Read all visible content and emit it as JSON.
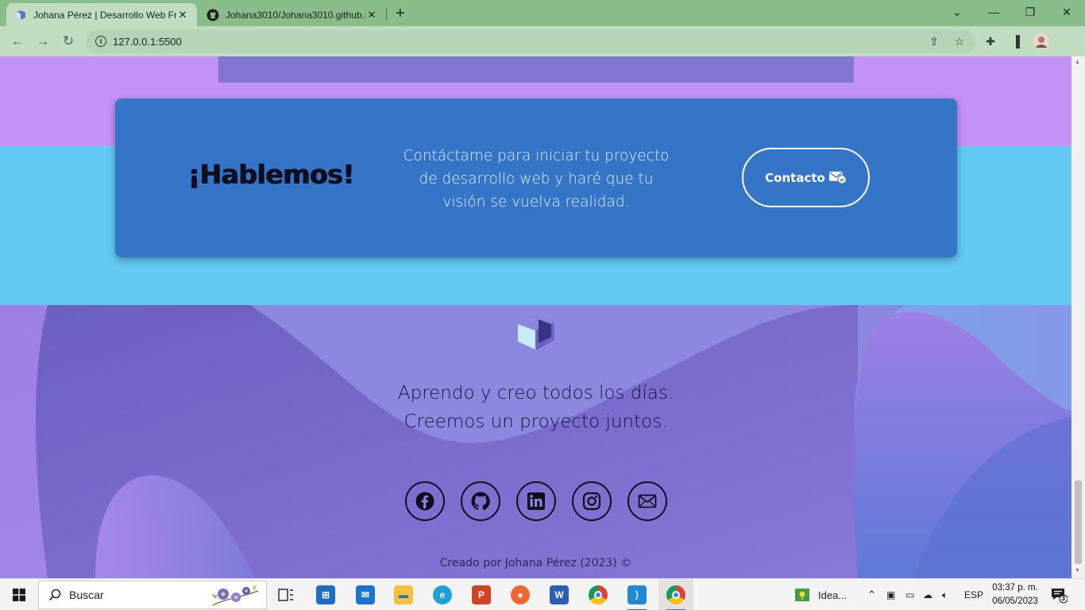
{
  "browser": {
    "tabs": [
      {
        "title": "Johana Pérez | Desarrollo Web Fr",
        "active": true
      },
      {
        "title": "Johana3010/Johana3010.github.i",
        "active": false
      }
    ],
    "new_tab": "+",
    "address": "127.0.0.1:5500"
  },
  "cta": {
    "title": "¡Hablemos!",
    "text": "Contáctame para iniciar tu proyecto de desarrollo web y haré que tu visión se vuelva realidad.",
    "button_label": "Contacto"
  },
  "footer": {
    "tagline_line1": "Aprendo y creo todos los días.",
    "tagline_line2": "Creemos un proyecto juntos.",
    "socials": [
      "facebook-icon",
      "github-icon",
      "linkedin-icon",
      "instagram-icon",
      "mail-icon"
    ],
    "credit": "Creado por Johana Pérez (2023) ©"
  },
  "taskbar": {
    "search_placeholder": "Buscar",
    "weather_label": "Idea...",
    "language": "ESP",
    "time": "03:37 p. m.",
    "date": "06/05/2023",
    "notifications": "3"
  },
  "colors": {
    "purple_band": "#c392f7",
    "cyan_band": "#63caf3",
    "cta_bg": "#3575c8",
    "tabbar": "#88bd8a"
  }
}
